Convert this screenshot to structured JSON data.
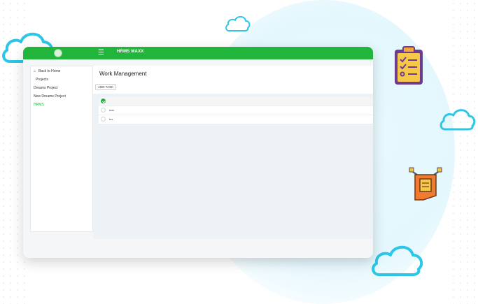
{
  "app": {
    "title": "HRMS MAXX"
  },
  "sidebar": {
    "items": [
      {
        "label": "Back to Home"
      },
      {
        "label": "Projects"
      },
      {
        "label": "Dreams Project"
      },
      {
        "label": "New Dreams Project"
      },
      {
        "label": "HRMS",
        "active": true
      }
    ]
  },
  "main": {
    "title": "Work Management",
    "add_button": "ADD TASK",
    "tasks": [
      {
        "label": "",
        "done": true
      },
      {
        "label": "task",
        "done": false
      },
      {
        "label": "tes",
        "done": false
      }
    ]
  },
  "colors": {
    "accent": "#22b53c",
    "cloud": "#2cc6e8",
    "background_circle": "#e3f7fd"
  },
  "icons": [
    "menu-icon",
    "home-icon",
    "check-icon",
    "clipboard-icon",
    "document-icon",
    "cloud-icon"
  ]
}
